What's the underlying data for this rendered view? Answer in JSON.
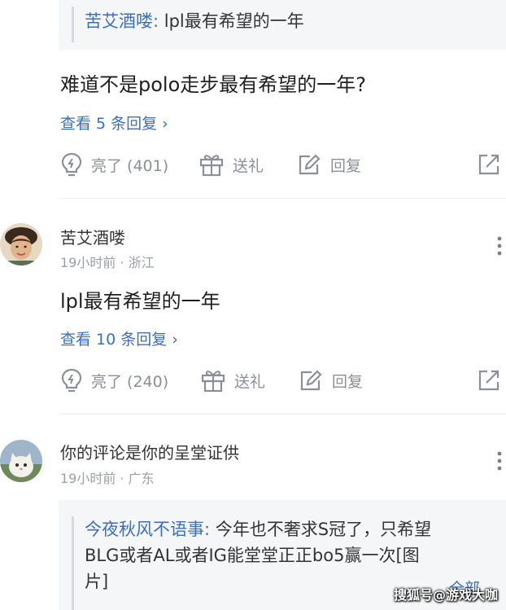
{
  "quote_top": {
    "author": "苦艾酒喽:",
    "text": " lpl最有希望的一年"
  },
  "comment1": {
    "text": "难道不是polo走步最有希望的一年?",
    "replies_label": "查看 5 条回复",
    "actions": {
      "like_label": "亮了 (401)",
      "gift_label": "送礼",
      "reply_label": "回复"
    }
  },
  "comment2": {
    "username": "苦艾酒喽",
    "meta": "19小时前 · 浙江",
    "text": "lpl最有希望的一年",
    "replies_label": "查看 10 条回复",
    "actions": {
      "like_label": "亮了 (240)",
      "gift_label": "送礼",
      "reply_label": "回复"
    }
  },
  "comment3": {
    "username": "你的评论是你的呈堂证供",
    "meta": "19小时前 · 广东",
    "quote": {
      "author": "今夜秋风不语事:",
      "line1": " 今年也不奢求S冠了，只希望",
      "line2": "BLG或者AL或者IG能堂堂正正bo5赢一次[图",
      "line3": "片]",
      "expand_label": "全部"
    }
  },
  "watermark": "搜狐号@游戏大咖",
  "colors": {
    "link_blue": "#3d6fb6",
    "muted_gray": "#8a8f99",
    "quote_bg": "#f5f6f8"
  },
  "icons": [
    "like-bulb-icon",
    "gift-icon",
    "reply-pen-icon",
    "share-icon",
    "more-dots-icon",
    "chevron-right-icon"
  ]
}
